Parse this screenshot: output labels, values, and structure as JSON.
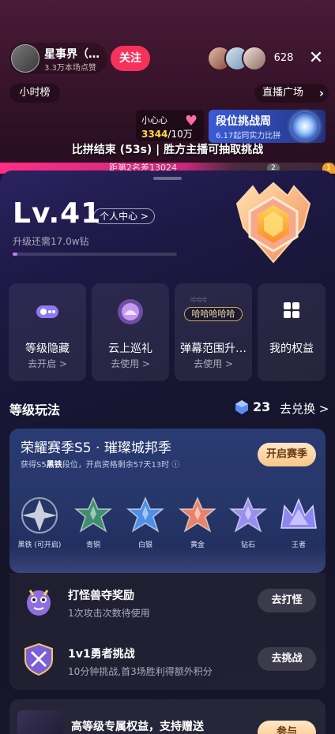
{
  "live": {
    "host_name": "星事界（…",
    "host_sub": "3.3万本场点赞",
    "follow_label": "关注",
    "viewer_count": "628",
    "close_icon": "close-icon",
    "hourly_rank": "小时榜",
    "plaza": "直播广场",
    "heart_label": "小心心",
    "heart_value": "3344",
    "heart_total": "/10万",
    "rank_week_title": "段位挑战周",
    "rank_week_sub": "6.17起同实力比拼",
    "pk_text": "比拼结束 (53s) | 胜方主播可抽取挑战",
    "pk_bar_text": "距第2名差13024",
    "pk_rank2": "2",
    "pk_rank1": "1"
  },
  "panel": {
    "level": "Lv.41",
    "center_label": "个人中心 >",
    "upgrade_text": "升级还需17.0w钻",
    "progress": 0.03,
    "cards": [
      {
        "title": "等级隐藏",
        "action": "去开启 >",
        "icon": "toggle-icon"
      },
      {
        "title": "云上巡礼",
        "action": "去使用 >",
        "icon": "cloud-parade-icon"
      },
      {
        "title": "弹幕范围升…",
        "action": "去使用 >",
        "icon": "danmaku-icon",
        "bubble": "哈哈哈哈哈",
        "bubble_bg": "哈哈哈"
      },
      {
        "title": "我的权益",
        "action": "",
        "icon": "grid-icon"
      }
    ],
    "section_title": "等级玩法",
    "gem_count": "23",
    "exchange_label": "去兑换 >",
    "season": {
      "title": "荣耀赛季S5 · 璀璨城邦季",
      "sub_prefix": "获得S5",
      "sub_bold": "黑铁",
      "sub_suffix": "段位，开启资格剩余57天13时 ⓘ",
      "open_label": "开启赛季",
      "tiers": [
        {
          "label": "黑铁 (可开启)",
          "color": "#c9d0dc"
        },
        {
          "label": "青铜",
          "color": "#3f8f6f"
        },
        {
          "label": "白银",
          "color": "#4f8fe6"
        },
        {
          "label": "黄金",
          "color": "#e8826a"
        },
        {
          "label": "钻石",
          "color": "#9a8ff0"
        },
        {
          "label": "王者",
          "color": "#8b86f2"
        }
      ]
    },
    "tasks": [
      {
        "title": "打怪兽夺奖励",
        "sub": "1次攻击次数待使用",
        "button": "去打怪",
        "icon": "monster-icon"
      },
      {
        "title": "1v1勇者挑战",
        "sub": "10分钟挑战,首3场胜利得额外积分",
        "button": "去挑战",
        "icon": "sword-shield-icon"
      }
    ],
    "bottom": {
      "title": "高等级专属权益，支持赠送",
      "button": "参与"
    }
  },
  "colors": {
    "follow": "#f6325c",
    "accent_gold": "#f7c689",
    "progress": "#c57cff"
  }
}
